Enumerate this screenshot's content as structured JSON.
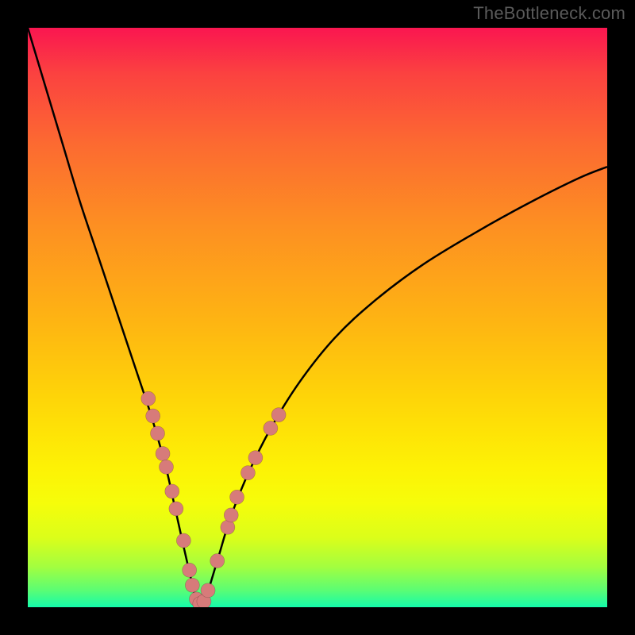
{
  "watermark": "TheBottleneck.com",
  "chart_data": {
    "type": "line",
    "title": "",
    "xlabel": "",
    "ylabel": "",
    "xlim": [
      0,
      100
    ],
    "ylim": [
      0,
      100
    ],
    "series": [
      {
        "name": "curve",
        "x": [
          0,
          3,
          6,
          9,
          12,
          15,
          17,
          19,
          21,
          22.5,
          24,
          25,
          26,
          27,
          27.8,
          28.5,
          29,
          29.5,
          30,
          30.7,
          31.5,
          33,
          35,
          38,
          42,
          47,
          53,
          60,
          68,
          77,
          86,
          95,
          100
        ],
        "y": [
          100,
          90,
          80,
          70,
          61,
          52,
          46,
          40,
          34,
          29,
          23.5,
          19,
          14.5,
          10,
          6.5,
          3.5,
          1.5,
          0.5,
          0.5,
          1.5,
          4,
          9,
          15.5,
          23,
          31,
          39,
          46.5,
          53,
          59,
          64.5,
          69.5,
          74,
          76
        ]
      }
    ],
    "markers": [
      {
        "x": 20.8,
        "y": 36.0
      },
      {
        "x": 21.6,
        "y": 33.0
      },
      {
        "x": 22.4,
        "y": 30.0
      },
      {
        "x": 23.3,
        "y": 26.5
      },
      {
        "x": 23.9,
        "y": 24.2
      },
      {
        "x": 24.9,
        "y": 20.0
      },
      {
        "x": 25.6,
        "y": 17.0
      },
      {
        "x": 26.9,
        "y": 11.5
      },
      {
        "x": 27.9,
        "y": 6.4
      },
      {
        "x": 28.4,
        "y": 3.8
      },
      {
        "x": 29.1,
        "y": 1.4
      },
      {
        "x": 29.7,
        "y": 0.6
      },
      {
        "x": 30.4,
        "y": 1.0
      },
      {
        "x": 31.1,
        "y": 2.9
      },
      {
        "x": 32.7,
        "y": 8.0
      },
      {
        "x": 34.5,
        "y": 13.8
      },
      {
        "x": 35.1,
        "y": 15.9
      },
      {
        "x": 36.1,
        "y": 19.0
      },
      {
        "x": 38.0,
        "y": 23.2
      },
      {
        "x": 39.3,
        "y": 25.8
      },
      {
        "x": 41.9,
        "y": 30.9
      },
      {
        "x": 43.3,
        "y": 33.2
      }
    ],
    "marker_color": "#d77b7a",
    "marker_radius": 9
  }
}
